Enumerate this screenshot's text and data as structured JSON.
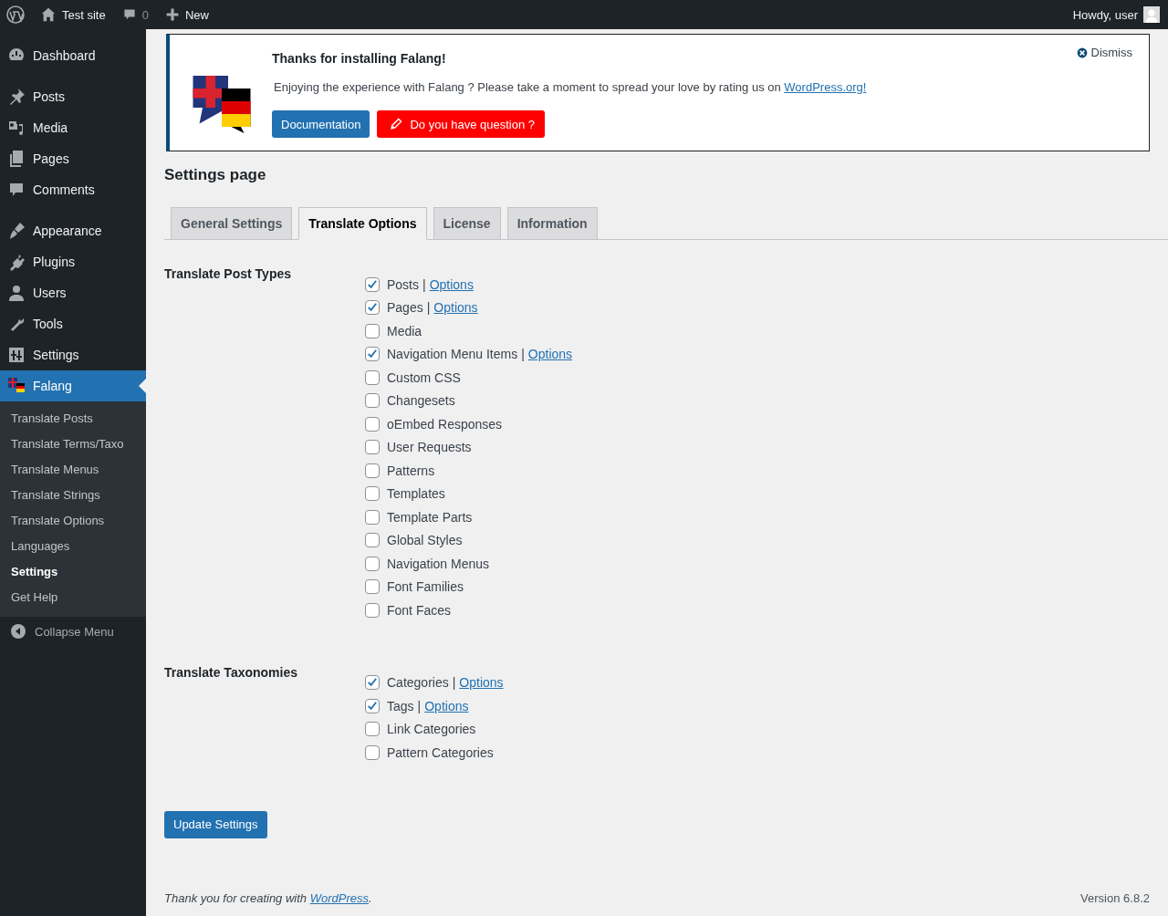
{
  "admin_bar": {
    "site": "Test site",
    "comments": "0",
    "new": "New",
    "greeting": "Howdy, user"
  },
  "sidebar": {
    "items": [
      {
        "label": "Dashboard",
        "kind": "dashboard",
        "selected": false
      },
      {
        "label": "Posts",
        "kind": "pin",
        "selected": false
      },
      {
        "label": "Media",
        "kind": "media",
        "selected": false
      },
      {
        "label": "Pages",
        "kind": "pages",
        "selected": false
      },
      {
        "label": "Comments",
        "kind": "comment",
        "selected": false
      },
      {
        "label": "Appearance",
        "kind": "brush",
        "selected": false
      },
      {
        "label": "Plugins",
        "kind": "plug",
        "selected": false
      },
      {
        "label": "Users",
        "kind": "user",
        "selected": false
      },
      {
        "label": "Tools",
        "kind": "wrench",
        "selected": false
      },
      {
        "label": "Settings",
        "kind": "sliders",
        "selected": false
      },
      {
        "label": "Falang",
        "kind": "flags",
        "selected": true
      }
    ],
    "submenu": [
      {
        "label": "Translate Posts",
        "selected": false
      },
      {
        "label": "Translate Terms/Taxo",
        "selected": false
      },
      {
        "label": "Translate Menus",
        "selected": false
      },
      {
        "label": "Translate Strings",
        "selected": false
      },
      {
        "label": "Translate Options",
        "selected": false
      },
      {
        "label": "Languages",
        "selected": false
      },
      {
        "label": "Settings",
        "selected": true
      },
      {
        "label": "Get Help",
        "selected": false
      }
    ],
    "collapse": "Collapse Menu"
  },
  "notice": {
    "title": "Thanks for installing Falang!",
    "text": "Enjoying the experience with Falang ? Please take a moment to spread your love by rating us on ",
    "link": "WordPress.org!",
    "dismiss": "Dismiss",
    "buttons": [
      {
        "label": "Documentation",
        "kind": "primary"
      },
      {
        "label": "Do you have question ?",
        "kind": "question"
      }
    ]
  },
  "page_title": "Settings page",
  "tabs": [
    {
      "label": "General Settings",
      "selected": false
    },
    {
      "label": "Translate Options",
      "selected": true
    },
    {
      "label": "License",
      "selected": false
    },
    {
      "label": "Information",
      "selected": false
    }
  ],
  "sections": [
    {
      "title": "Translate Post Types",
      "items": [
        {
          "label": "Posts",
          "checked": true,
          "separator": "|",
          "link": "Options"
        },
        {
          "label": "Pages",
          "checked": true,
          "separator": "|",
          "link": "Options"
        },
        {
          "label": "Media",
          "checked": false
        },
        {
          "label": "Navigation Menu Items",
          "checked": true,
          "separator": "|",
          "link": "Options"
        },
        {
          "label": "Custom CSS",
          "checked": false
        },
        {
          "label": "Changesets",
          "checked": false
        },
        {
          "label": "oEmbed Responses",
          "checked": false
        },
        {
          "label": "User Requests",
          "checked": false
        },
        {
          "label": "Patterns",
          "checked": false
        },
        {
          "label": "Templates",
          "checked": false
        },
        {
          "label": "Template Parts",
          "checked": false
        },
        {
          "label": "Global Styles",
          "checked": false
        },
        {
          "label": "Navigation Menus",
          "checked": false
        },
        {
          "label": "Font Families",
          "checked": false
        },
        {
          "label": "Font Faces",
          "checked": false
        }
      ]
    },
    {
      "title": "Translate Taxonomies",
      "items": [
        {
          "label": "Categories",
          "checked": true,
          "separator": "|",
          "link": "Options"
        },
        {
          "label": "Tags",
          "checked": true,
          "separator": "|",
          "link": "Options"
        },
        {
          "label": "Link Categories",
          "checked": false
        },
        {
          "label": "Pattern Categories",
          "checked": false
        }
      ]
    }
  ],
  "submit": "Update Settings",
  "footer": {
    "text": "Thank you for creating with ",
    "link": "WordPress",
    "after": ".",
    "version": "Version 6.8.2"
  }
}
